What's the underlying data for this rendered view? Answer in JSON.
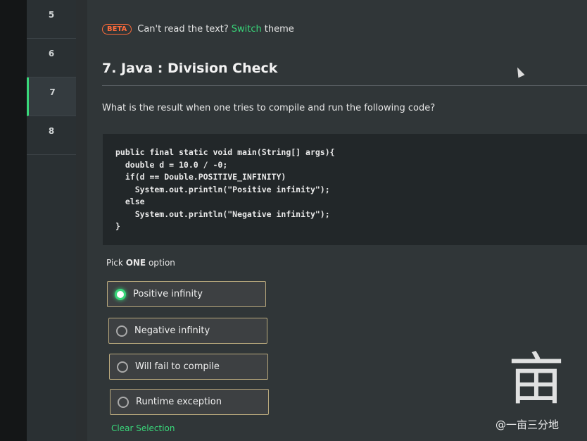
{
  "sidebar": {
    "items": [
      {
        "label": "5"
      },
      {
        "label": "6"
      },
      {
        "label": "7"
      },
      {
        "label": "8"
      }
    ],
    "active_index": 2
  },
  "banner": {
    "badge": "BETA",
    "text": "Can't read the text?",
    "link": "Switch",
    "suffix": "theme"
  },
  "question": {
    "title": "7. Java : Division Check",
    "prompt": "What is the result when one tries to compile and run the following code?",
    "code_lines": [
      "public final static void main(String[] args){",
      "  double d = 10.0 / -0;",
      "  if(d == Double.POSITIVE_INFINITY)",
      "    System.out.println(\"Positive infinity\");",
      "  else",
      "    System.out.println(\"Negative infinity\");",
      "}"
    ]
  },
  "options": {
    "pick_prefix": "Pick",
    "pick_count": "ONE",
    "pick_suffix": "option",
    "items": [
      {
        "label": "Positive infinity",
        "selected": true
      },
      {
        "label": "Negative infinity",
        "selected": false
      },
      {
        "label": "Will fail to compile",
        "selected": false
      },
      {
        "label": "Runtime exception",
        "selected": false
      }
    ],
    "clear_label": "Clear Selection"
  },
  "watermark": {
    "logo_char": "亩",
    "text": "@一亩三分地"
  },
  "colors": {
    "accent": "#39d77a",
    "beta": "#ff6b3a",
    "option_border": "#b9a97d"
  }
}
